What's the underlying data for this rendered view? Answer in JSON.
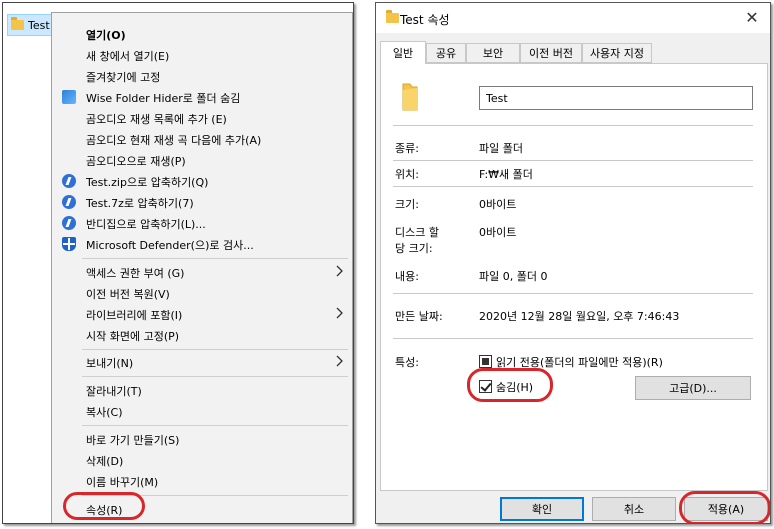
{
  "explorer": {
    "item_label": "Test"
  },
  "context_menu": {
    "items": [
      {
        "label": "열기(O)",
        "bold": true,
        "icon": ""
      },
      {
        "label": "새 창에서 열기(E)",
        "icon": ""
      },
      {
        "label": "즐겨찾기에 고정",
        "icon": ""
      },
      {
        "label": "Wise Folder Hider로 폴더 숨김",
        "icon": "wise-folder-hider-icon"
      },
      {
        "label": "곰오디오 재생 목록에 추가 (E)",
        "icon": ""
      },
      {
        "label": "곰오디오 현재 재생 곡 다음에 추가(A)",
        "icon": ""
      },
      {
        "label": "곰오디오으로 재생(P)",
        "icon": ""
      },
      {
        "label": "Test.zip으로 압축하기(Q)",
        "icon": "bandizip-icon"
      },
      {
        "label": "Test.7z로 압축하기(7)",
        "icon": "bandizip-icon"
      },
      {
        "label": "반디집으로 압축하기(L)...",
        "icon": "bandizip-icon"
      },
      {
        "label": "Microsoft Defender(으)로 검사...",
        "icon": "defender-shield-icon"
      },
      {
        "label": "액세스 권한 부여 (G)",
        "submenu": true
      },
      {
        "label": "이전 버전 복원(V)"
      },
      {
        "label": "라이브러리에 포함(I)",
        "submenu": true
      },
      {
        "label": "시작 화면에 고정(P)"
      },
      {
        "label": "보내기(N)",
        "submenu": true
      },
      {
        "label": "잘라내기(T)"
      },
      {
        "label": "복사(C)"
      },
      {
        "label": "바로 가기 만들기(S)"
      },
      {
        "label": "삭제(D)"
      },
      {
        "label": "이름 바꾸기(M)"
      },
      {
        "label": "속성(R)",
        "highlighted": true
      }
    ]
  },
  "dialog": {
    "title": "Test 속성",
    "close_glyph": "✕",
    "tabs": [
      "일반",
      "공유",
      "보안",
      "이전 버전",
      "사용자 지정"
    ],
    "active_tab": "일반",
    "name_value": "Test",
    "fields": {
      "type_label": "종류:",
      "type_value": "파일 폴더",
      "location_label": "위치:",
      "location_value": "F:₩새 폴더",
      "size_label": "크기:",
      "size_value": "0바이트",
      "disk_size_label_1": "디스크 할",
      "disk_size_label_2": "당 크기:",
      "disk_size_value": "0바이트",
      "contents_label": "내용:",
      "contents_value": "파일 0, 폴더 0",
      "created_label": "만든 날짜:",
      "created_value": "2020년 12월 28일 월요일, 오후 7:46:43",
      "attributes_label": "특성:"
    },
    "attributes": {
      "readonly_label": "읽기 전용(폴더의 파일에만 적용)(R)",
      "readonly_state": "indeterminate",
      "hidden_label": "숨김(H)",
      "hidden_checked": true,
      "advanced_button": "고급(D)..."
    },
    "buttons": {
      "ok": "확인",
      "cancel": "취소",
      "apply": "적용(A)"
    }
  },
  "colors": {
    "highlight_oval": "#d9262a",
    "selection": "#cce8ff",
    "folder": "#f3c34a"
  }
}
